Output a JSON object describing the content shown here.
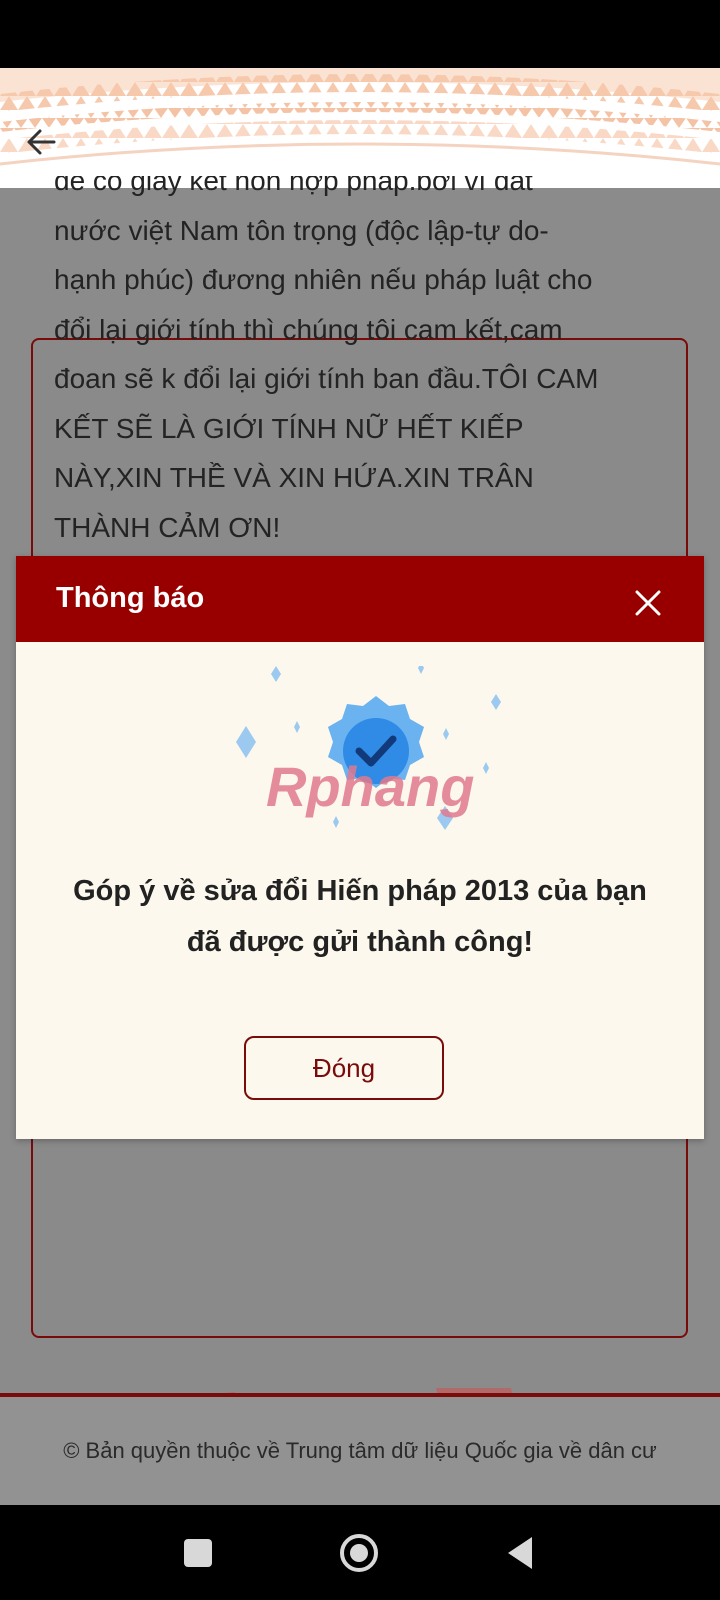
{
  "header": {
    "back_icon": "arrow-left-icon"
  },
  "content": {
    "text": "để có giấy kết hôn hợp pháp.bởi vì đất\nnước việt Nam tôn trọng (độc lập-tự do-\nhạnh phúc) đương nhiên nếu pháp luật cho\nđổi lại giới tính thì chúng tôi cam kết,cam\nđoan sẽ k đổi lại giới tính ban đầu.TÔI CAM\nKẾT SẼ LÀ GIỚI TÍNH NỮ HẾT KIẾP\nNÀY,XIN THỀ VÀ XIN HỨA.XIN TRÂN\nTHÀNH CẢM ƠN!"
  },
  "dialog": {
    "title": "Thông báo",
    "close_icon": "close-icon",
    "illustration_icon": "verified-badge-icon",
    "watermark": "Rphang",
    "message": "Góp ý về sửa đổi Hiến pháp 2013 của bạn\nđã được gửi thành công!",
    "button_label": "Đóng"
  },
  "footer": {
    "text": "© Bản quyền thuộc về Trung tâm dữ liệu Quốc gia về dân cư"
  },
  "nav": {
    "recent_icon": "square-icon",
    "home_icon": "circle-icon",
    "back_icon": "triangle-back-icon"
  },
  "colors": {
    "primary": "#980000",
    "dialog_bg": "#fcf8ed",
    "overlay": "#8b8b8b"
  }
}
